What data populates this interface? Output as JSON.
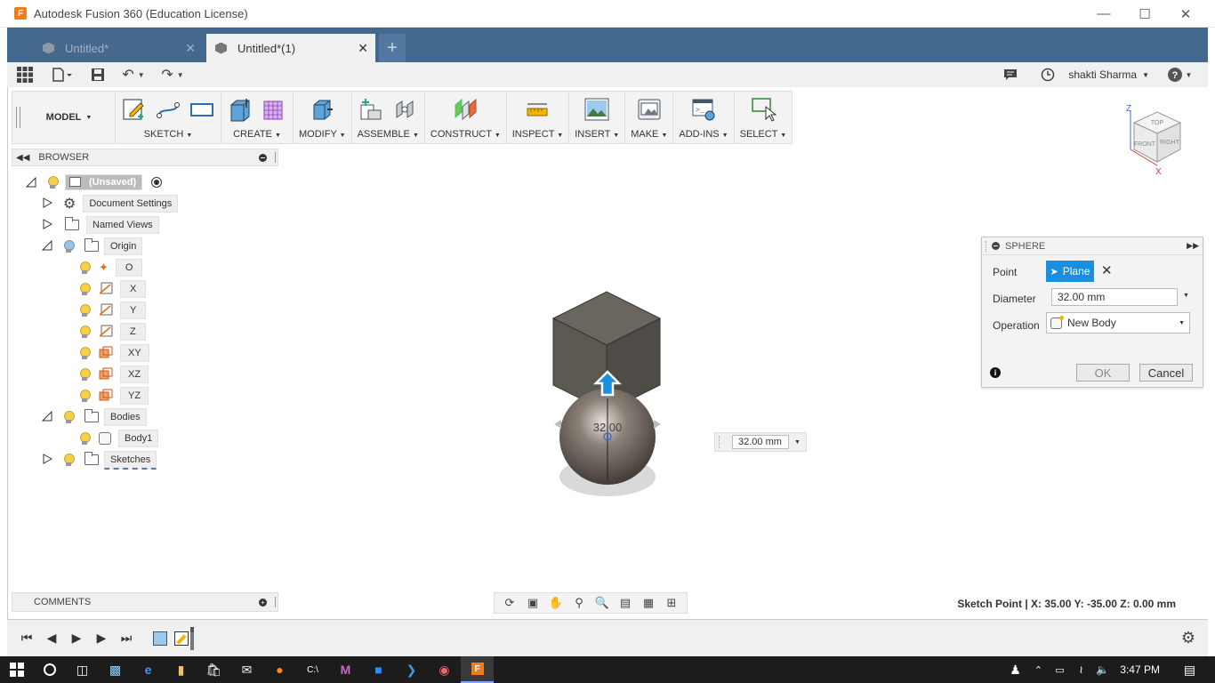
{
  "window": {
    "title": "Autodesk Fusion 360 (Education License)",
    "app_icon_letter": "F"
  },
  "tabs": [
    {
      "label": "Untitled*",
      "active": false
    },
    {
      "label": "Untitled*(1)",
      "active": true
    }
  ],
  "tab_add_label": "+",
  "user": {
    "name": "shakti Sharma"
  },
  "ribbon": {
    "workspace": "MODEL",
    "groups": {
      "sketch": "SKETCH",
      "create": "CREATE",
      "modify": "MODIFY",
      "assemble": "ASSEMBLE",
      "construct": "CONSTRUCT",
      "inspect": "INSPECT",
      "insert": "INSERT",
      "make": "MAKE",
      "addins": "ADD-INS",
      "select": "SELECT"
    }
  },
  "browser": {
    "title": "BROWSER",
    "root": "(Unsaved)",
    "items": {
      "doc_settings": "Document Settings",
      "named_views": "Named Views",
      "origin": "Origin",
      "o": "O",
      "x": "X",
      "y": "Y",
      "z": "Z",
      "xy": "XY",
      "xz": "XZ",
      "yz": "YZ",
      "bodies": "Bodies",
      "body1": "Body1",
      "sketches": "Sketches"
    }
  },
  "viewcube": {
    "top": "TOP",
    "front": "FRONT",
    "right": "RIGHT",
    "axis_x": "X",
    "axis_z": "Z"
  },
  "canvas": {
    "sphere_label": "32.00",
    "floating_input": "32.00 mm"
  },
  "dialog": {
    "title": "SPHERE",
    "point_label": "Point",
    "point_value": "Plane",
    "diameter_label": "Diameter",
    "diameter_value": "32.00 mm",
    "operation_label": "Operation",
    "operation_value": "New Body",
    "ok": "OK",
    "cancel": "Cancel"
  },
  "comments": {
    "title": "COMMENTS"
  },
  "status": {
    "text": "Sketch Point | X: 35.00 Y: -35.00 Z: 0.00 mm"
  },
  "taskbar": {
    "time": "3:47 PM"
  }
}
